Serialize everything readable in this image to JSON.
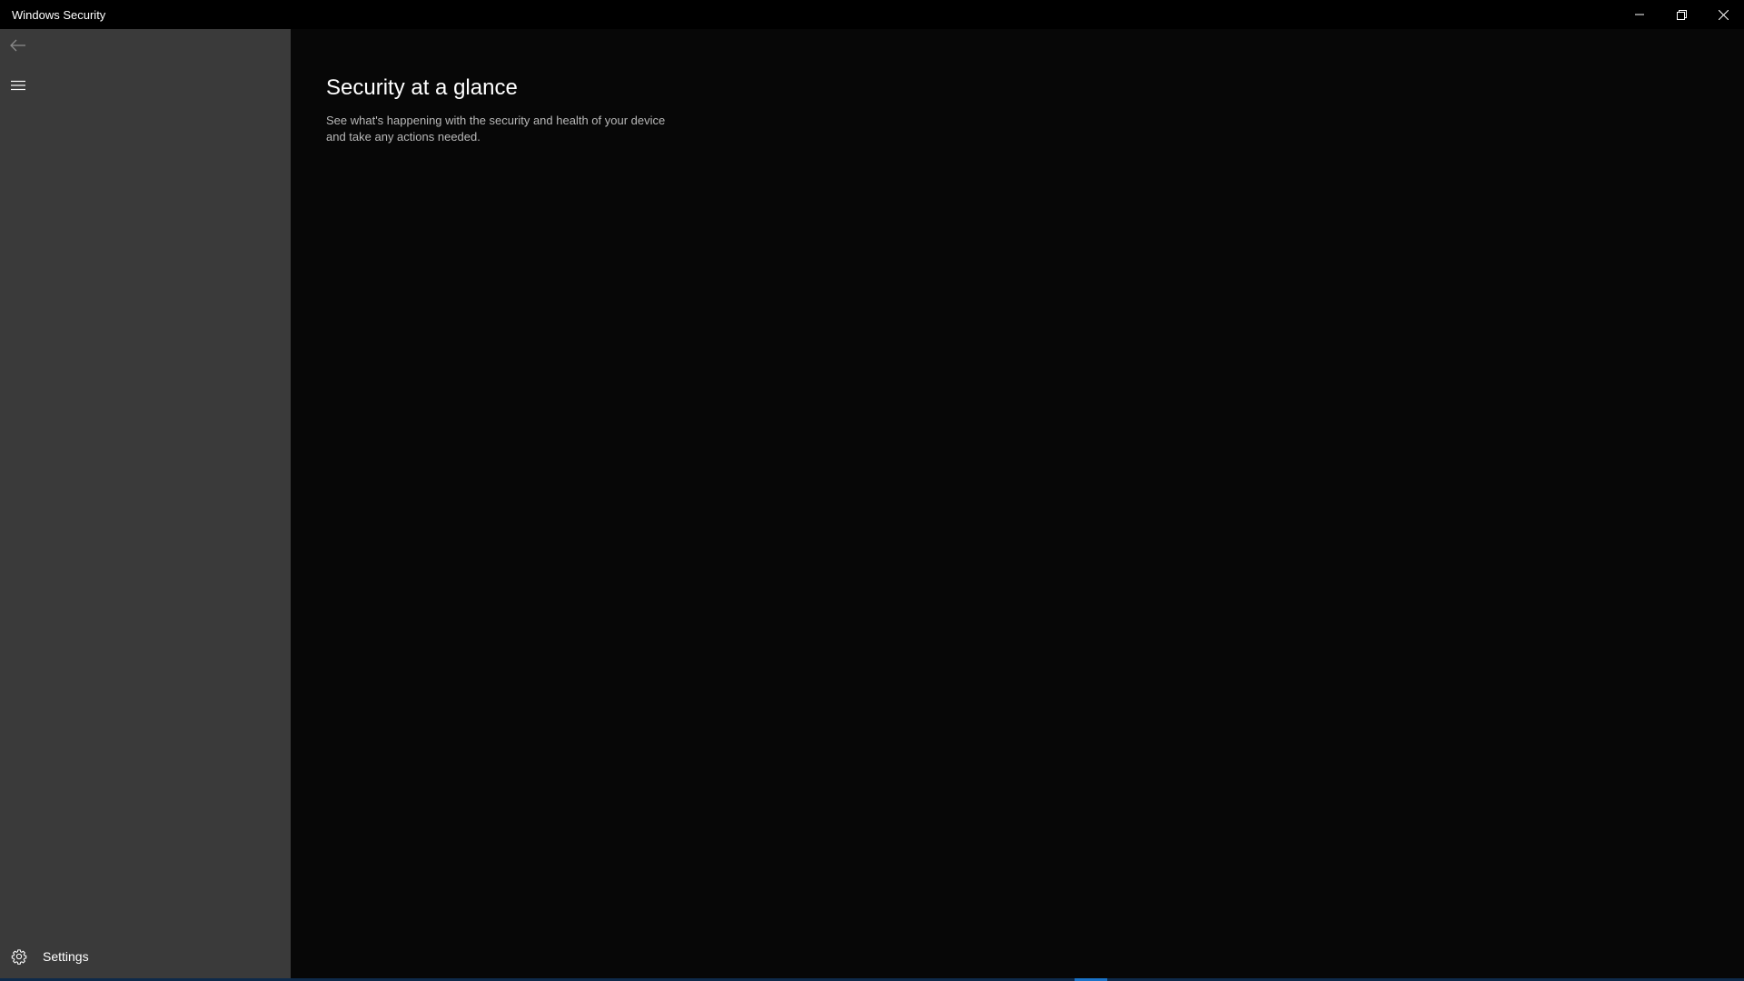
{
  "window": {
    "title": "Windows Security"
  },
  "caption_buttons": [
    {
      "name": "minimize",
      "icon": "minimize-icon"
    },
    {
      "name": "restore",
      "icon": "restore-icon"
    },
    {
      "name": "close",
      "icon": "close-icon"
    }
  ],
  "sidebar": {
    "back_icon": "back-arrow-icon",
    "menu_icon": "hamburger-menu-icon",
    "settings": {
      "label": "Settings",
      "icon": "gear-icon"
    }
  },
  "main": {
    "title": "Security at a glance",
    "subtitle": "See what's happening with the security and health of your device and take any actions needed."
  },
  "colors": {
    "sidebar_bg": "#3a3a3a",
    "main_bg": "#070707",
    "titlebar_bg": "#000000",
    "text_primary": "#ffffff",
    "text_secondary": "#b8b8b8",
    "accent": "#1a73c8"
  }
}
